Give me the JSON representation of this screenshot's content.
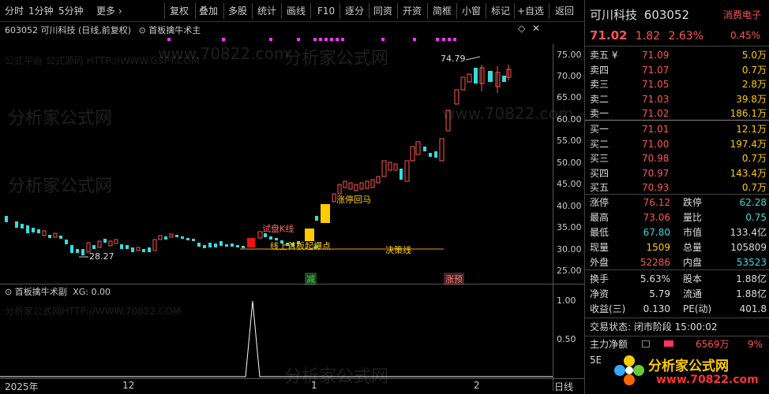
{
  "toolbar": {
    "items": [
      "分时",
      "1分钟",
      "5分钟",
      "更多 ›",
      "复权",
      "叠加",
      "多股",
      "统计",
      "画线",
      "F10",
      "逐分",
      "同资",
      "开资",
      "简框",
      "小窗",
      "标记",
      "+自选",
      "返回"
    ]
  },
  "chart_header": {
    "title": "603052 可川科技 (日线,前复权)",
    "indicator": "首板擒牛术主",
    "settings_icon": "diamond-icon",
    "close_icon": "close-icon"
  },
  "watermark": {
    "left_text": "公式平台 公式源码 HTTP://WWW.GSPT.COM",
    "main": "分析家公式网",
    "url": "www.70822.com",
    "sub_left": "分析家公式网HTTP://WWW.70822.COM"
  },
  "annotations": {
    "high": "74.79",
    "low": "28.27",
    "trial_k": "试盘K线",
    "pullback": "涨停回马",
    "online": "线上首板起爆点",
    "decision": "决策线",
    "sell_marker": "减",
    "hint_marker": "涨预"
  },
  "price_axis": [
    "75.00",
    "70.00",
    "65.00",
    "60.00",
    "55.00",
    "50.00",
    "45.00",
    "40.00",
    "35.00",
    "30.00",
    "25.00"
  ],
  "sub_header": {
    "name": "首板擒牛术副",
    "value": "XG: 0.00"
  },
  "sub_axis": [
    "1.00",
    "0.50"
  ],
  "date_axis": {
    "start": "2025年",
    "m12": "12",
    "m1": "1",
    "m2": "2",
    "label": "日线"
  },
  "stock": {
    "name": "可川科技",
    "code": "603052",
    "price": "71.02",
    "change": "1.82",
    "pct": "2.63%",
    "sector": "消费电子",
    "sector_pct": "0.45%"
  },
  "asks": [
    {
      "l": "卖五 ¥",
      "p": "71.09",
      "v": "5.0万"
    },
    {
      "l": "卖四",
      "p": "71.07",
      "v": "0.7万"
    },
    {
      "l": "卖三",
      "p": "71.05",
      "v": "2.8万"
    },
    {
      "l": "卖二",
      "p": "71.03",
      "v": "39.8万"
    },
    {
      "l": "卖一",
      "p": "71.02",
      "v": "186.1万"
    }
  ],
  "bids": [
    {
      "l": "买一",
      "p": "71.01",
      "v": "12.1万"
    },
    {
      "l": "买二",
      "p": "71.00",
      "v": "197.4万"
    },
    {
      "l": "买三",
      "p": "70.98",
      "v": "0.7万"
    },
    {
      "l": "买四",
      "p": "70.97",
      "v": "143.4万"
    },
    {
      "l": "买五",
      "p": "70.93",
      "v": "0.7万"
    }
  ],
  "stats": [
    {
      "l1": "涨停",
      "v1": "76.12",
      "c1": "red",
      "l2": "跌停",
      "v2": "62.28",
      "c2": "grn"
    },
    {
      "l1": "最高",
      "v1": "73.06",
      "c1": "red",
      "l2": "量比",
      "v2": "0.75",
      "c2": "grn"
    },
    {
      "l1": "最低",
      "v1": "67.80",
      "c1": "grn",
      "l2": "市值",
      "v2": "133.4亿",
      "c2": "wht"
    },
    {
      "l1": "现量",
      "v1": "1509",
      "c1": "ylw",
      "l2": "总量",
      "v2": "105809",
      "c2": "wht"
    },
    {
      "l1": "外盘",
      "v1": "52286",
      "c1": "red",
      "l2": "内盘",
      "v2": "53523",
      "c2": "grn"
    }
  ],
  "stats2": [
    {
      "l1": "换手",
      "v1": "5.63%",
      "l2": "股本",
      "v2": "1.88亿"
    },
    {
      "l1": "净资",
      "v1": "5.79",
      "l2": "流通",
      "v2": "1.88亿"
    },
    {
      "l1": "收益(三)",
      "v1": "0.130",
      "l2": "PE(动)",
      "v2": "401.8"
    }
  ],
  "trade_status": "交易状态: 闭市阶段 15:00:02",
  "main_flow": {
    "label": "主力净额",
    "value": "6569万",
    "pct": "9%"
  },
  "bottom_logo": {
    "text": "分析家公式网",
    "url": "www.70822.com",
    "left": "5E"
  }
}
